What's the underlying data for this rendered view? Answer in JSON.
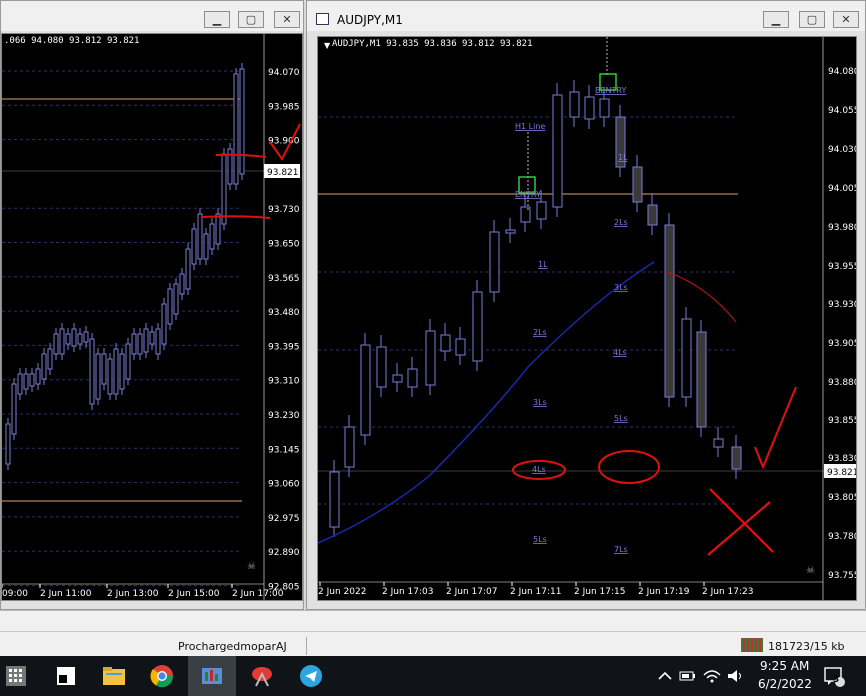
{
  "left_window": {
    "header": ".066 94.080 93.812 93.821",
    "price_levels": [
      "94.070",
      "93.985",
      "93.900",
      "93.821",
      "93.730",
      "93.650",
      "93.565",
      "93.480",
      "93.395",
      "93.310",
      "93.230",
      "93.145",
      "93.060",
      "92.975",
      "92.890",
      "92.805"
    ],
    "current_price": "93.821",
    "time_labels": [
      "09:00",
      "2 Jun 11:00",
      "2 Jun 13:00",
      "2 Jun 15:00",
      "2 Jun 17:00"
    ]
  },
  "right_window": {
    "title": "AUDJPY,M1",
    "header": "AUDJPY,M1  93.835 93.836 93.812 93.821",
    "price_levels": [
      "94.080",
      "94.055",
      "94.030",
      "94.005",
      "93.980",
      "93.955",
      "93.930",
      "93.905",
      "93.880",
      "93.855",
      "93.830",
      "93.821",
      "93.805",
      "93.780",
      "93.755"
    ],
    "current_price": "93.821",
    "time_labels": [
      "2 Jun 2022",
      "2 Jun 17:03",
      "2 Jun 17:07",
      "2 Jun 17:11",
      "2 Jun 17:15",
      "2 Jun 17:19",
      "2 Jun 17:23"
    ],
    "annotations": [
      "BENTRY",
      "H1 Line",
      "1L",
      "ENTRY",
      "2Ls",
      "1L",
      "3Ls",
      "2Ls",
      "4Ls",
      "3Ls",
      "5Ls",
      "4Ls",
      "5Ls",
      "7Ls"
    ]
  },
  "status": {
    "profile": "ProchargedmoparAJ",
    "traffic": "181723/15 kb"
  },
  "taskbar": {
    "time": "9:25 AM",
    "date": "6/2/2022",
    "notifications": "3"
  },
  "colors": {
    "candle": "#7b7bd6",
    "ma_line": "#1a2bb0",
    "level_line": "#e0a060",
    "annotation_red": "#e01010",
    "grid": "#2f2f60"
  }
}
